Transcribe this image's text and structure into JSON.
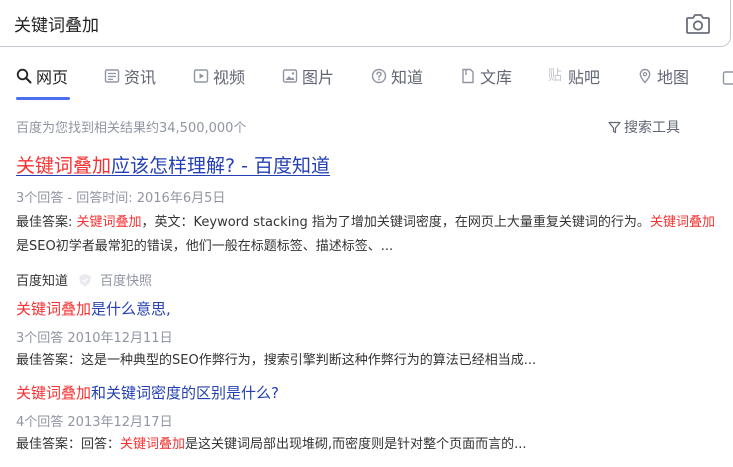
{
  "search": {
    "query": "关键词叠加"
  },
  "tabs": [
    {
      "label": "网页",
      "icon": "search-icon"
    },
    {
      "label": "资讯",
      "icon": "news-icon"
    },
    {
      "label": "视频",
      "icon": "video-icon"
    },
    {
      "label": "图片",
      "icon": "image-icon"
    },
    {
      "label": "知道",
      "icon": "question-icon"
    },
    {
      "label": "文库",
      "icon": "document-icon"
    },
    {
      "label": "贴吧",
      "icon": "tieba-icon"
    },
    {
      "label": "地图",
      "icon": "map-pin-icon"
    }
  ],
  "results_info": {
    "count_text": "百度为您找到相关结果约34,500,000个",
    "tools_label": "搜索工具"
  },
  "main_result": {
    "title_hl": "关键词叠加",
    "title_rest": "应该怎样理解? - 百度知道",
    "meta": "3个回答 - 回答时间: 2016年6月5日",
    "abstract": {
      "p1": "最佳答案: ",
      "hl1": "关键词叠加",
      "p2": "，英文：Keyword stacking 指为了增加关键词密度，在网页上大量重复关键词的行为。",
      "hl2": "关键词叠加",
      "p3": "是SEO初学者最常犯的错误，他们一般在标题标签、描述标签、..."
    },
    "source": "百度知道",
    "snapshot": "百度快照"
  },
  "sub_results": [
    {
      "title_hl": "关键词叠加",
      "title_rest": "是什么意思,",
      "meta": "3个回答  2010年12月11日",
      "abstract": {
        "p1": "最佳答案：这是一种典型的SEO作弊行为，搜索引擎判断这种作弊行为的算法已经相当成...",
        "hl": "",
        "p2": ""
      }
    },
    {
      "title_hl": "关键词叠加",
      "title_rest": "和关键词密度的区别是什么?",
      "meta": "4个回答  2013年12月17日",
      "abstract": {
        "p1": "最佳答案：回答：",
        "hl": "关键词叠加",
        "p2": "是这关键词局部出现堆砌,而密度则是针对整个页面而言的..."
      }
    }
  ],
  "colors": {
    "accent": "#4e6ef2",
    "highlight": "#f73131",
    "link": "#2440b3"
  }
}
